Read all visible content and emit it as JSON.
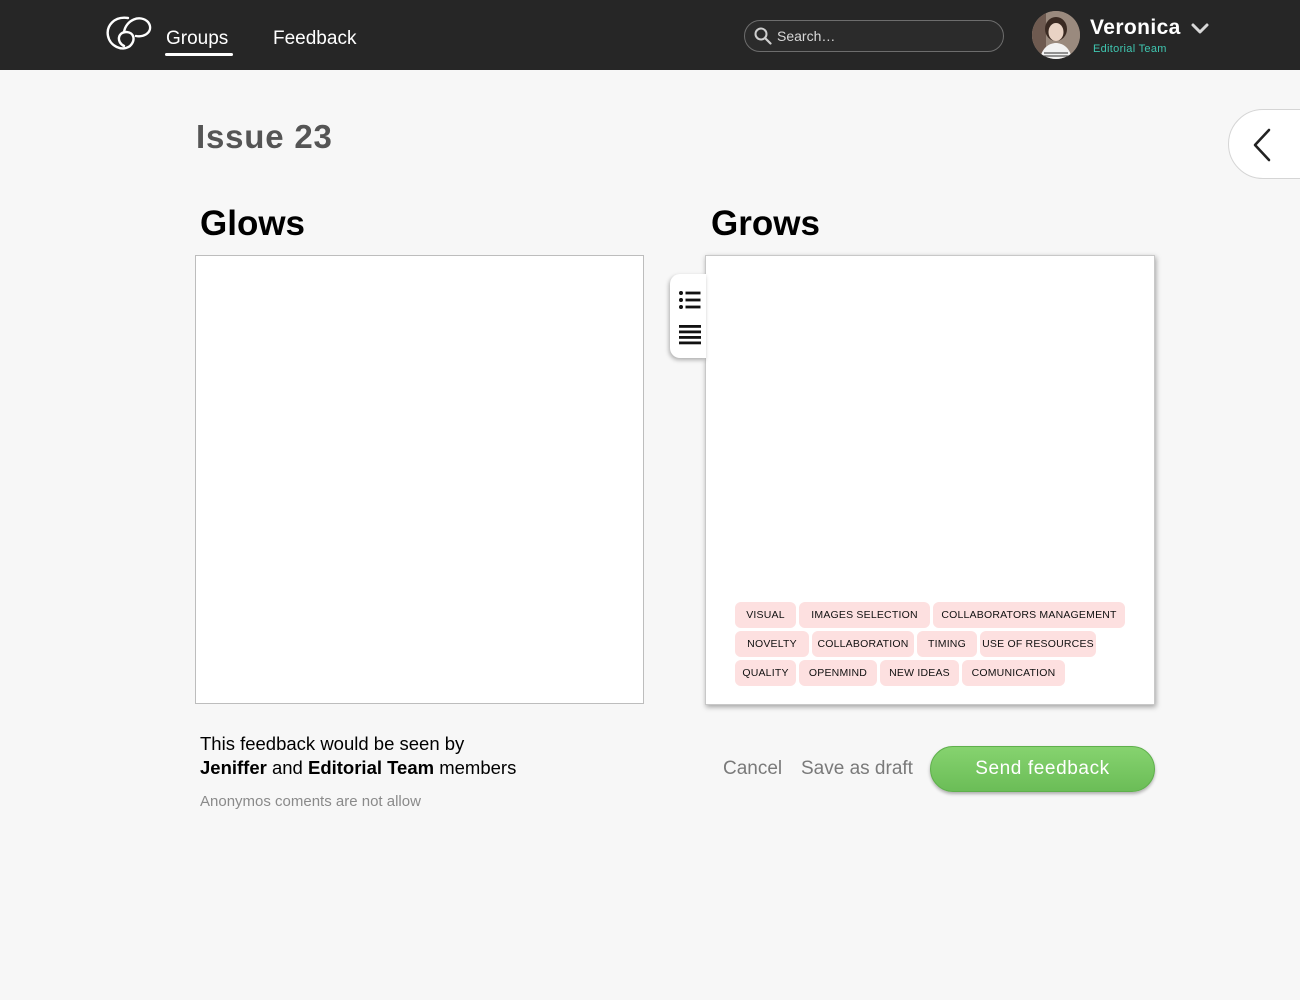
{
  "nav": {
    "groups_label": "Groups",
    "feedback_label": "Feedback"
  },
  "search": {
    "placeholder": "Search…"
  },
  "user": {
    "name": "Veronica",
    "team": "Editorial Team"
  },
  "page": {
    "title": "Issue 23"
  },
  "glows": {
    "heading": "Glows"
  },
  "grows": {
    "heading": "Grows",
    "tags": [
      "VISUAL",
      "IMAGES SELECTION",
      "COLLABORATORS MANAGEMENT",
      "NOVELTY",
      "COLLABORATION",
      "TIMING",
      "USE OF RESOURCES",
      "QUALITY",
      "OPENMIND",
      "NEW IDEAS",
      "COMUNICATION"
    ]
  },
  "visibility": {
    "line1": "This feedback would be seen by",
    "person": "Jeniffer",
    "and": "and",
    "team": "Editorial Team",
    "members": "members",
    "anon_note": "Anonymos coments are not allow"
  },
  "actions": {
    "cancel": "Cancel",
    "save_draft": "Save as draft",
    "send": "Send feedback"
  }
}
